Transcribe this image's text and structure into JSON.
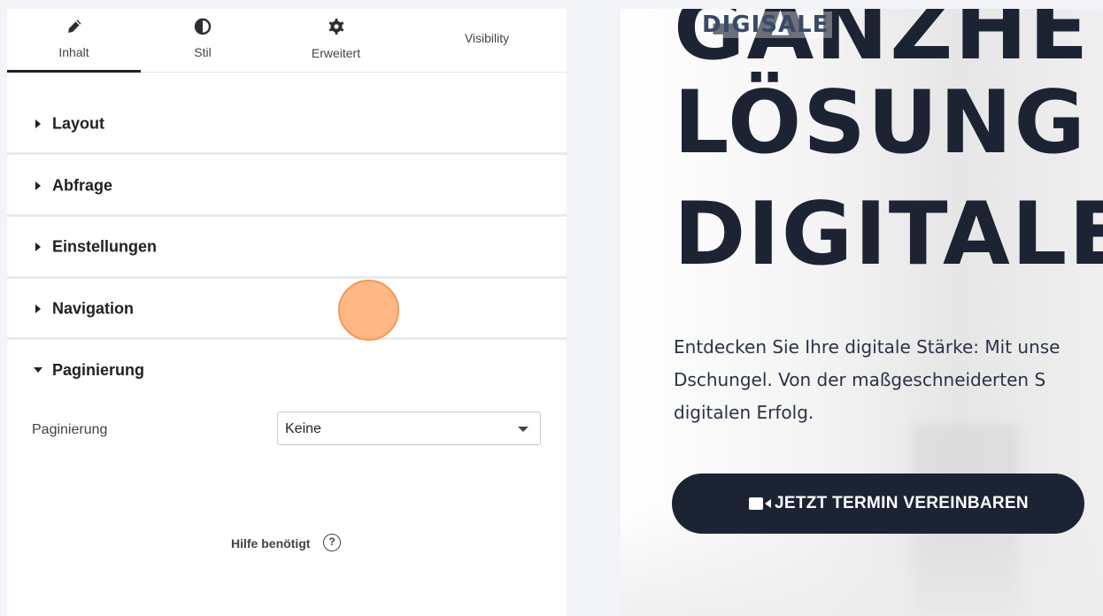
{
  "editor": {
    "tabs": [
      {
        "label": "Inhalt",
        "icon": "pencil-icon",
        "active": true
      },
      {
        "label": "Stil",
        "icon": "contrast-icon",
        "active": false
      },
      {
        "label": "Erweitert",
        "icon": "gear-icon",
        "active": false
      },
      {
        "label": "Visibility",
        "icon": "",
        "active": false
      }
    ],
    "sections": [
      {
        "label": "Layout",
        "expanded": false
      },
      {
        "label": "Abfrage",
        "expanded": false
      },
      {
        "label": "Einstellungen",
        "expanded": false
      },
      {
        "label": "Navigation",
        "expanded": false
      },
      {
        "label": "Paginierung",
        "expanded": true
      }
    ],
    "pagination": {
      "field_label": "Paginierung",
      "select_value": "Keine"
    },
    "help": {
      "label": "Hilfe benötigt",
      "icon_glyph": "?"
    }
  },
  "preview": {
    "logo": "DIGISALE",
    "hero_lines": [
      "GANZHE",
      "LÖSUNG",
      "DIGITALE"
    ],
    "paragraph_lines": [
      "Entdecken Sie Ihre digitale Stärke: Mit unse",
      "Dschungel. Von der maßgeschneiderten S",
      "digitalen Erfolg."
    ],
    "cta_label": "JETZT TERMIN VEREINBAREN",
    "cta_icon": "video-camera-icon"
  },
  "colors": {
    "accent_dark": "#1c2434",
    "cursor_highlight": "#ffab70"
  }
}
